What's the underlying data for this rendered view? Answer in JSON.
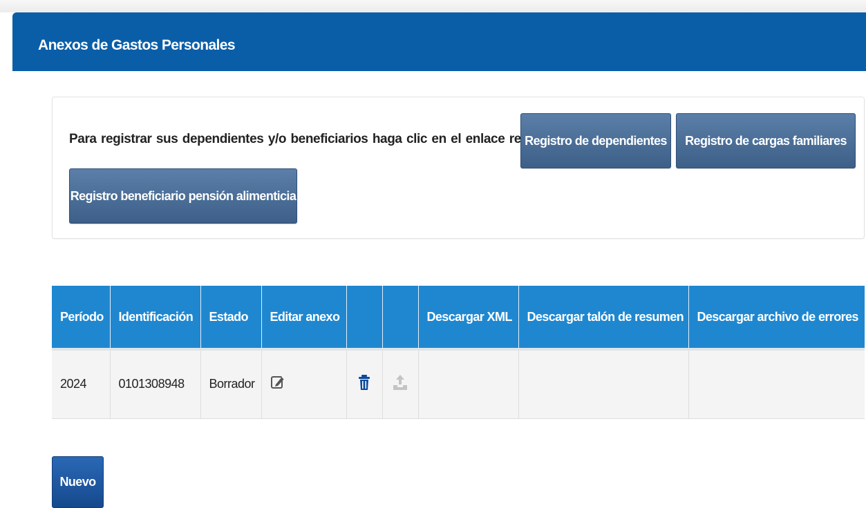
{
  "header": {
    "title": "Anexos de Gastos Personales"
  },
  "info_panel": {
    "text": "Para registrar sus dependientes y/o beneficiarios haga clic en el enlace respectivo",
    "buttons": {
      "dependientes": "Registro de dependientes",
      "cargas": "Registro de cargas familiares",
      "pension": "Registro beneficiario pensión alimenticia"
    }
  },
  "table": {
    "headers": [
      "Período",
      "Identificación",
      "Estado",
      "Editar anexo",
      "",
      "",
      "Descargar XML",
      "Descargar talón de resumen",
      "Descargar archivo de errores"
    ],
    "rows": [
      {
        "periodo": "2024",
        "identificacion": "0101308948",
        "estado": "Borrador"
      }
    ]
  },
  "actions": {
    "nuevo": "Nuevo"
  },
  "icons": {
    "edit": "edit-icon",
    "delete": "trash-icon",
    "upload": "upload-icon"
  },
  "colors": {
    "header_bg": "#0a5ea8",
    "table_header_bg": "#1f87d0",
    "button_bg": "#4a6d95",
    "nuevo_bg": "#1f5aa3",
    "trash": "#0b4a9a"
  }
}
